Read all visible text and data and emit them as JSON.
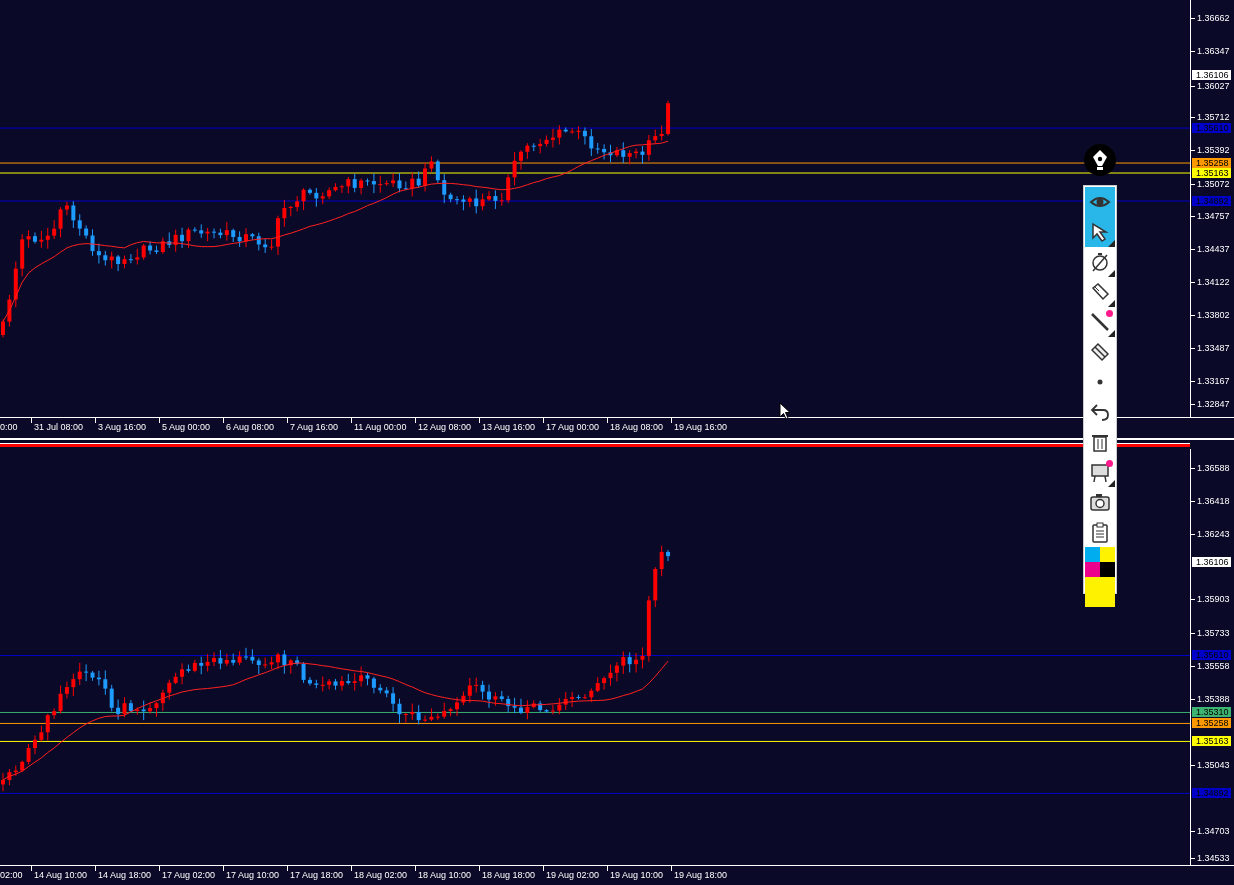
{
  "charts": [
    {
      "price_ticks": [
        "1.36662",
        "1.36347",
        "1.36027",
        "1.35712",
        "1.35392",
        "1.35072",
        "1.34757",
        "1.34437",
        "1.34122",
        "1.33802",
        "1.33487",
        "1.33167",
        "1.32847"
      ],
      "price_labels": [
        {
          "text": "1.36106",
          "color": "#ffffff",
          "kind": "current"
        },
        {
          "text": "1.35610",
          "color": "#0000c8",
          "kind": "level"
        },
        {
          "text": "1.35258",
          "color": "#ff9900",
          "kind": "level"
        },
        {
          "text": "1.35163",
          "color": "#ffff00",
          "kind": "level"
        },
        {
          "text": "1.34892",
          "color": "#0000c8",
          "kind": "level"
        }
      ],
      "time_labels": [
        "0:00",
        "31 Jul 08:00",
        "3 Aug 16:00",
        "5 Aug 00:00",
        "6 Aug 08:00",
        "7 Aug 16:00",
        "11 Aug 00:00",
        "12 Aug 08:00",
        "13 Aug 16:00",
        "17 Aug 00:00",
        "18 Aug 08:00",
        "19 Aug 16:00"
      ]
    },
    {
      "price_ticks": [
        "1.36588",
        "1.36418",
        "1.36243",
        "1.35903",
        "1.35733",
        "1.35558",
        "1.35388",
        "1.35043",
        "1.34703",
        "1.34533"
      ],
      "price_labels": [
        {
          "text": "1.36106",
          "color": "#ffffff",
          "kind": "current"
        },
        {
          "text": "1.35610",
          "color": "#0000c8",
          "kind": "level"
        },
        {
          "text": "1.35310",
          "color": "#3cb371",
          "kind": "level"
        },
        {
          "text": "1.35258",
          "color": "#ff9900",
          "kind": "level"
        },
        {
          "text": "1.35163",
          "color": "#ffff00",
          "kind": "level"
        },
        {
          "text": "1.34892",
          "color": "#0000c8",
          "kind": "level"
        }
      ],
      "time_labels": [
        "02:00",
        "14 Aug 10:00",
        "14 Aug 18:00",
        "17 Aug 02:00",
        "17 Aug 10:00",
        "17 Aug 18:00",
        "18 Aug 02:00",
        "18 Aug 10:00",
        "18 Aug 18:00",
        "19 Aug 02:00",
        "19 Aug 10:00",
        "19 Aug 18:00"
      ]
    }
  ],
  "toolbar": {
    "tools": [
      {
        "selected": true,
        "has_dot": false,
        "has_submenu": false
      },
      {
        "selected": true,
        "has_dot": false,
        "has_submenu": true
      },
      {
        "selected": false,
        "has_dot": false,
        "has_submenu": true
      },
      {
        "selected": false,
        "has_dot": false,
        "has_submenu": true
      },
      {
        "selected": false,
        "has_dot": true,
        "has_submenu": true
      },
      {
        "selected": false,
        "has_dot": false,
        "has_submenu": false
      },
      {
        "selected": false,
        "has_dot": false,
        "has_submenu": false
      },
      {
        "selected": false,
        "has_dot": false,
        "has_submenu": false
      },
      {
        "selected": false,
        "has_dot": false,
        "has_submenu": false
      },
      {
        "selected": false,
        "has_dot": true,
        "has_submenu": true
      },
      {
        "selected": false,
        "has_dot": false,
        "has_submenu": false
      },
      {
        "selected": false,
        "has_dot": false,
        "has_submenu": false
      }
    ],
    "palette": [
      {
        "color": "#00aeef"
      },
      {
        "color": "#fff200"
      },
      {
        "color": "#ec008c"
      },
      {
        "color": "#000000"
      },
      {
        "color": "#fff200"
      }
    ]
  }
}
